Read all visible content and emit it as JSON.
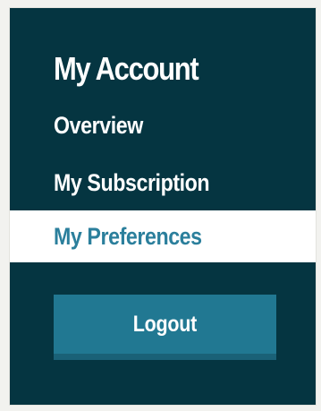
{
  "account_menu": {
    "title": "My Account",
    "items": [
      {
        "label": "Overview",
        "active": false
      },
      {
        "label": "My Subscription",
        "active": false
      },
      {
        "label": "My Preferences",
        "active": true
      }
    ],
    "logout_label": "Logout"
  },
  "colors": {
    "panel_background": "#053541",
    "active_item_background": "#ffffff",
    "active_item_text": "#2b7f9c",
    "logout_button": "#217892"
  }
}
